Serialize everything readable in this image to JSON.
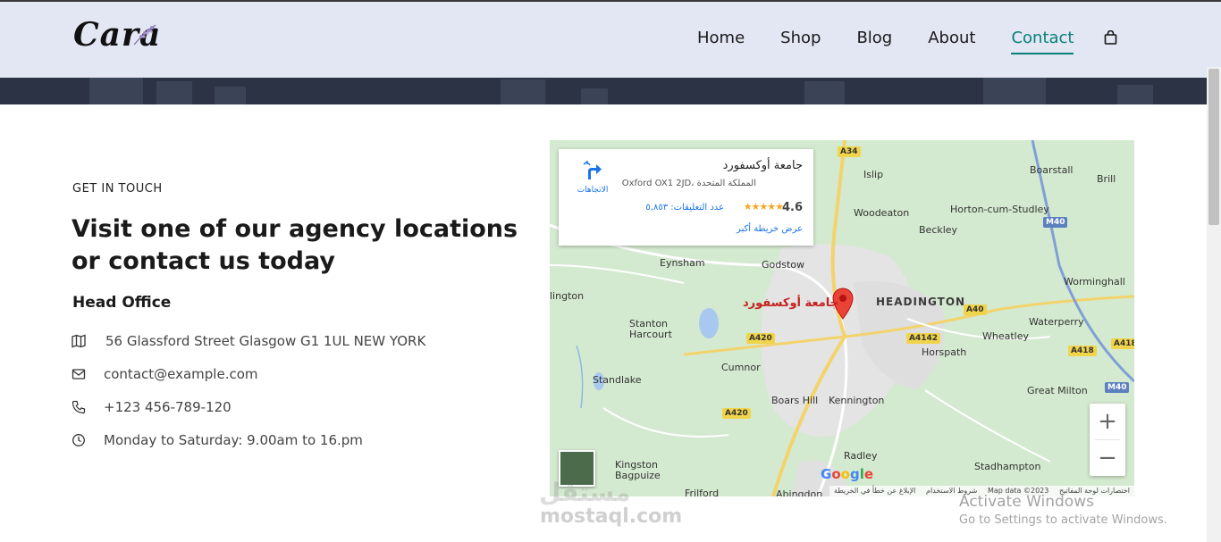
{
  "header": {
    "logo": "Cara",
    "nav": [
      "Home",
      "Shop",
      "Blog",
      "About",
      "Contact"
    ],
    "active": "Contact",
    "cart_icon": "shopping-bag-icon"
  },
  "contact": {
    "eyebrow": "GET IN TOUCH",
    "headline_1": "Visit one of our agency locations",
    "headline_2": "or contact us today",
    "office_title": "Head Office",
    "address": "56 Glassford Street Glasgow G1 1UL NEW YORK",
    "email": "contact@example.com",
    "phone": "+123 456-789-120",
    "hours": "Monday to Saturday: 9.00am to 16.pm"
  },
  "map": {
    "card": {
      "name": "جامعة أوكسفورد",
      "address": "Oxford OX1 2JD، المملكة المتحدة",
      "rating": "4.6",
      "stars": "★★★★★",
      "reviews": "عدد التعليقات: ٥,٨٥٣",
      "larger_map": "عرض خريطة أكبر",
      "directions": "الاتجاهات"
    },
    "pin_label": "جامعة أوكسفورد",
    "places": [
      "Islip",
      "Boarstall",
      "Brill",
      "Woodeaton",
      "Horton-cum-Studley",
      "Beckley",
      "Eynsham",
      "Godstow",
      "HEADINGTON",
      "Worminghall",
      "Stanton Harcourt",
      "Waterperry",
      "Wheatley",
      "Horspath",
      "Cumnor",
      "Standlake",
      "Boars Hill",
      "Kennington",
      "Great Milton",
      "Radley",
      "Kingston Bagpuize",
      "Stadhampton",
      "Frilford",
      "Abingdon",
      "lington"
    ],
    "roads": [
      "A34",
      "M40",
      "A40",
      "A420",
      "A4142",
      "A418"
    ],
    "zoom_in": "+",
    "zoom_out": "−",
    "attribution": {
      "shortcuts": "اختصارات لوحة المفاتيح",
      "data": "Map data ©2023",
      "terms": "شروط الاستخدام",
      "report": "الإبلاغ عن خطأ في الخريطة"
    },
    "google": "Google"
  },
  "overlay": {
    "watermark": "mostaql.com",
    "watermark_ar": "مستقل",
    "activate_title": "Activate Windows",
    "activate_sub": "Go to Settings to activate Windows."
  }
}
